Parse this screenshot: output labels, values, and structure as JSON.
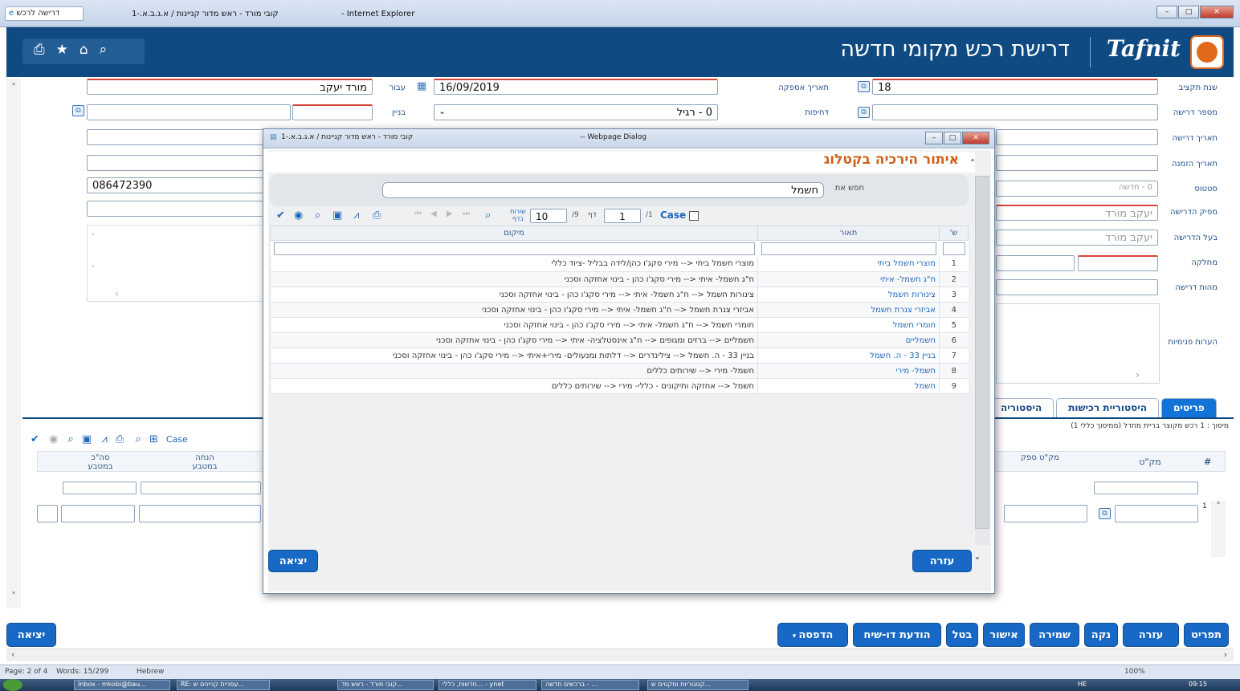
{
  "ie": {
    "tab_label": "דרישה לרכש",
    "window_title": "קובי מורד - ראש מדור קניינות / א.ג.ב.א.-1",
    "browser": "- Internet Explorer"
  },
  "app": {
    "title": "דרישת רכש מקומי חדשה",
    "logo": "Tafnit",
    "toolbar_icons": [
      "print-icon",
      "star-icon",
      "home-icon",
      "search-icon"
    ]
  },
  "form": {
    "fiscal_year": {
      "label": "שנת תקציב",
      "value": "18"
    },
    "request_number": {
      "label": "מספר דרישה",
      "value": ""
    },
    "request_date": {
      "label": "תאריך דרישה",
      "value": ""
    },
    "order_date": {
      "label": "תאריך הזמנה",
      "value": ""
    },
    "status": {
      "label": "סטטוס",
      "value": "0 - חדשה"
    },
    "issuer": {
      "label": "מפיק הדרישה",
      "value": "יעקב מורד"
    },
    "owner": {
      "label": "בעל הדרישה",
      "value": "יעקב מורד"
    },
    "department": {
      "label": "מחלקה",
      "value": ""
    },
    "nature": {
      "label": "מהות דרישה",
      "value": ""
    },
    "internal_notes": {
      "label": "הערות פנימיות",
      "value": ""
    },
    "supply_date": {
      "label": "תאריך אספקה",
      "value": "16/09/2019"
    },
    "urgency": {
      "label": "דחיפות",
      "value": "0 - רגיל"
    },
    "for": {
      "label": "עבור",
      "value": "מורד יעקב"
    },
    "building": {
      "label": "בניין",
      "value": ""
    },
    "phone": {
      "value": "086472390"
    }
  },
  "tabs": [
    "פריטים",
    "היסטוריית רכישות",
    "היסטוריה"
  ],
  "summary_line": "מיסוך : 1 רכש מקוצר בריית מחדל (ממיסוך כללי 1)",
  "items_grid": {
    "case_label": "Case",
    "columns": [
      "#",
      "מק\"ט",
      "מק\"ט ספק",
      "הנחה במטבע",
      "סה\"כ במטבע"
    ],
    "row_index": "1"
  },
  "bottom_buttons": [
    "תפריט",
    "עזרה",
    "נקה",
    "שמירה",
    "אישור",
    "בטל",
    "הודעת דו-שיח",
    "הדפסה"
  ],
  "exit_label": "יציאה",
  "dialog": {
    "title": "קובי מורד - ראש מדור קניינות / א.ג.ב.א.-1",
    "subtitle": "-- Webpage Dialog",
    "heading": "איתור הירכיה בקטלוג",
    "search_label": "חפש את",
    "search_value": "חשמל",
    "pager": {
      "rows_per_page_label": "שורות בדף",
      "rows_per_page": "10",
      "page": "1",
      "of_pages": "/1",
      "of_total": "/9",
      "page_label": "דף",
      "case_label": "Case"
    },
    "columns": {
      "index": "ש'",
      "description": "תאור",
      "location": "מיקום"
    },
    "rows": [
      {
        "n": "1",
        "desc": "מוצרי חשמל ביתי",
        "loc": "מוצרי חשמל ביתי <-- מירי סקג'ו כהן/לידה בבליל -ציוד כללי"
      },
      {
        "n": "2",
        "desc": "ח\"ג חשמל- איתי",
        "loc": "ח\"ג חשמל- איתי <-- מירי סקג'ו כהן - בינוי אחזקה וסכני"
      },
      {
        "n": "3",
        "desc": "צינורות חשמל",
        "loc": "צינורות חשמל <-- ח\"ג חשמל- איתי <-- מירי סקג'ו כהן - בינוי אחזקה וסכני"
      },
      {
        "n": "4",
        "desc": "אביזרי צנרת חשמל",
        "loc": "אביזרי צנרת חשמל <-- ח\"ג חשמל- איתי <-- מירי סקג'ו כהן - בינוי אחזקה וסכני"
      },
      {
        "n": "5",
        "desc": "חומרי חשמל",
        "loc": "חומרי חשמל <-- ח\"ג חשמל- איתי <-- מירי סקג'ו כהן - בינוי אחזקה וסכני"
      },
      {
        "n": "6",
        "desc": "חשמליים",
        "loc": "חשמליים <-- ברזים ומגופים <-- ח\"ג אינסטלציה- איתי <-- מירי סקג'ו כהן - בינוי אחזקה וסכני"
      },
      {
        "n": "7",
        "desc": "בניין 33 - ה. חשמל",
        "loc": "בניין 33 - ה. חשמל <-- צילינדרים <-- דלתות ומנעולים- מירי+איתי <-- מירי סקג'ו כהן - בינוי אחזקה וסכני"
      },
      {
        "n": "8",
        "desc": "חשמל- מירי",
        "loc": "חשמל- מירי <-- שירותים כללים"
      },
      {
        "n": "9",
        "desc": "חשמל",
        "loc": "חשמל <-- אחזקה ותיקונים - כללי- מירי <-- שירותים כללים"
      }
    ],
    "help_label": "עזרה",
    "exit_label": "יציאה"
  },
  "statusbar": {
    "page": "Page: 2 of 4",
    "words": "Words: 15/299",
    "lang": "Hebrew",
    "zoom": "100%"
  },
  "taskbar": {
    "items": [
      "Inbox - mkobi@bau...",
      "RE: עפניית קניינים ש...",
      "קובי מורד - ראש מד...",
      "חדשות, כללי... - ynet",
      "ברכשים חדשה - ...",
      "קטגוריות ומקטים ש..."
    ],
    "lang": "HE",
    "clock": "09:15"
  }
}
